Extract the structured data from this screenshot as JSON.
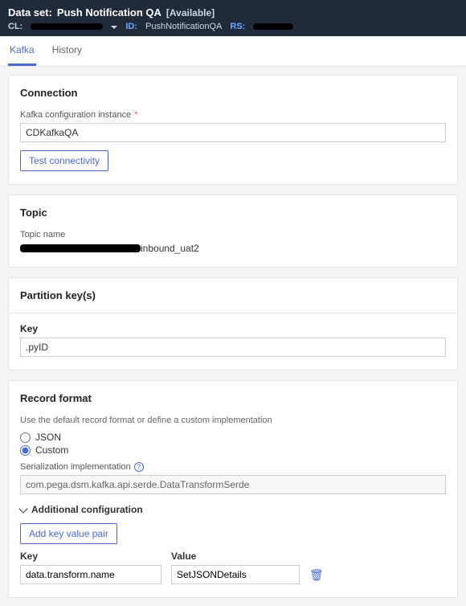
{
  "header": {
    "title_prefix": "Data set:",
    "title": "Push Notification QA",
    "status": "[Available]",
    "cl_label": "CL:",
    "id_label": "ID:",
    "id_value": "PushNotificationQA",
    "rs_label": "RS:"
  },
  "tabs": {
    "kafka": "Kafka",
    "history": "History",
    "activeIndex": 0
  },
  "connection": {
    "heading": "Connection",
    "instance_label": "Kafka configuration instance",
    "instance_value": "CDKafkaQA",
    "test_btn": "Test connectivity"
  },
  "topic": {
    "heading": "Topic",
    "name_label": "Topic name",
    "name_suffix": "inbound_uat2"
  },
  "partition": {
    "heading": "Partition key(s)",
    "key_label": "Key",
    "key_value": ".pyID"
  },
  "record": {
    "heading": "Record format",
    "helper": "Use the default record format or define a custom implementation",
    "json_label": "JSON",
    "custom_label": "Custom",
    "selected": "custom",
    "serialization_label": "Serialization implementation",
    "serialization_value": "com.pega.dsm.kafka.api.serde.DataTransformSerde",
    "additional_label": "Additional configuration",
    "add_pair_btn": "Add key value pair",
    "key_header": "Key",
    "value_header": "Value",
    "pairs": [
      {
        "key": "data.transform.name",
        "value": "SetJSONDetails"
      }
    ]
  }
}
